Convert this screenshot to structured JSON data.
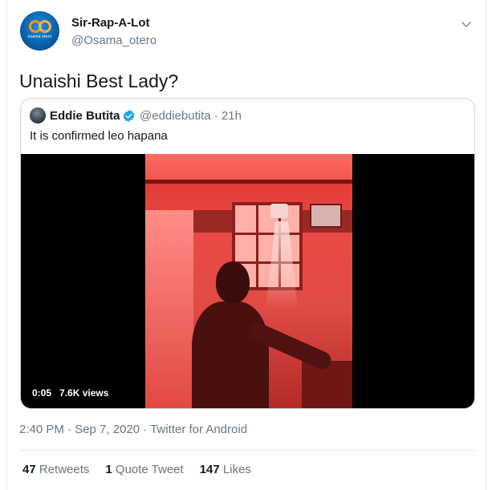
{
  "author": {
    "display_name": "Sir-Rap-A-Lot",
    "handle": "@Osama_otero",
    "avatar_text": "osama otero"
  },
  "tweet": {
    "text": "Unaishi Best Lady?",
    "timestamp": "2:40 PM · Sep 7, 2020 · Twitter for Android"
  },
  "quoted": {
    "display_name": "Eddie Butita",
    "meta": "@eddiebutita · 21h",
    "text": "It is confirmed leo hapana",
    "video": {
      "time": "0:05",
      "views": "7.6K views"
    }
  },
  "stats": {
    "retweets_count": "47",
    "retweets_label": "Retweets",
    "quotes_count": "1",
    "quotes_label": "Quote Tweet",
    "likes_count": "147",
    "likes_label": "Likes"
  },
  "colors": {
    "text_primary": "#14171a",
    "text_secondary": "#657786",
    "verified_blue": "#1da1f2",
    "border": "#e6ecf0"
  },
  "icons": [
    "chevron-down-icon",
    "verified-badge-icon"
  ]
}
